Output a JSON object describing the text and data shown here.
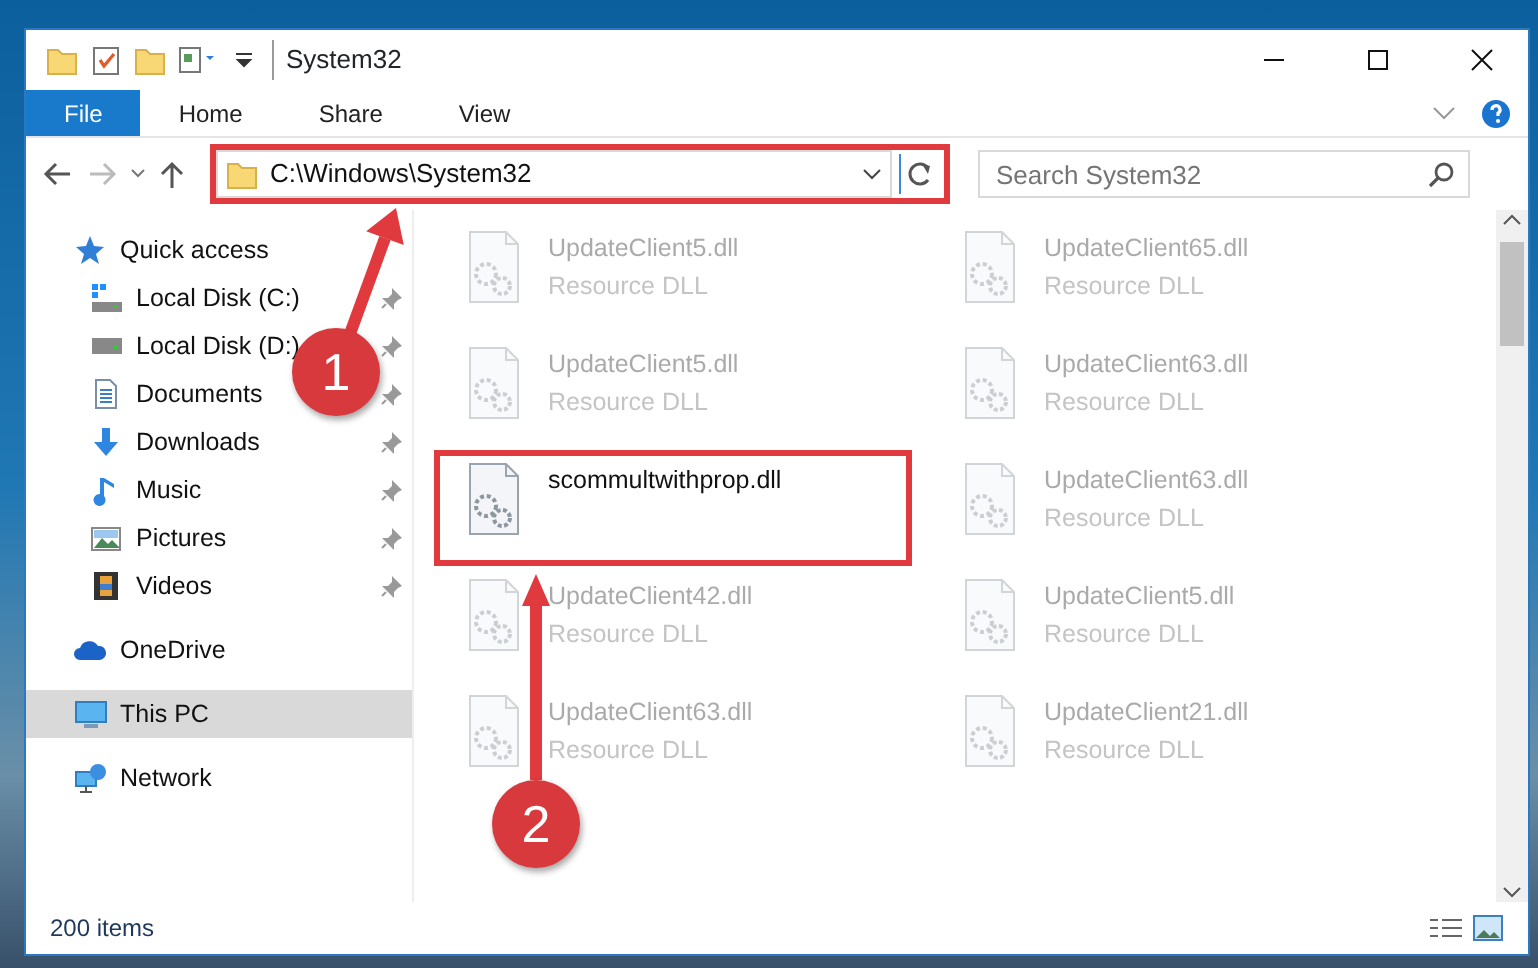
{
  "window": {
    "title": "System32"
  },
  "ribbon": {
    "tabs": [
      {
        "label": "File",
        "selected": true
      },
      {
        "label": "Home",
        "selected": false
      },
      {
        "label": "Share",
        "selected": false
      },
      {
        "label": "View",
        "selected": false
      }
    ]
  },
  "address": {
    "path": "C:\\Windows\\System32",
    "highlighted": true
  },
  "search": {
    "placeholder": "Search System32"
  },
  "nav": [
    {
      "label": "Quick access",
      "kind": "star",
      "selected": false,
      "children": [
        {
          "label": "Local Disk (C:)",
          "kind": "system-drive",
          "pinned": true,
          "selected": false
        },
        {
          "label": "Local Disk (D:)",
          "kind": "drive",
          "pinned": true,
          "selected": false
        },
        {
          "label": "Documents",
          "kind": "documents",
          "pinned": true,
          "selected": false
        },
        {
          "label": "Downloads",
          "kind": "downloads",
          "pinned": true,
          "selected": false
        },
        {
          "label": "Music",
          "kind": "music",
          "pinned": true,
          "selected": false
        },
        {
          "label": "Pictures",
          "kind": "pictures",
          "pinned": true,
          "selected": false
        },
        {
          "label": "Videos",
          "kind": "videos",
          "pinned": true,
          "selected": false
        }
      ]
    },
    {
      "label": "OneDrive",
      "kind": "cloud",
      "selected": false
    },
    {
      "label": "This PC",
      "kind": "computer",
      "selected": true
    },
    {
      "label": "Network",
      "kind": "network",
      "selected": false
    }
  ],
  "files": [
    {
      "name": "UpdateClient5.dll",
      "type": "Resource DLL",
      "selected": false
    },
    {
      "name": "UpdateClient65.dll",
      "type": "Resource DLL",
      "selected": false
    },
    {
      "name": "UpdateClient5.dll",
      "type": "Resource DLL",
      "selected": false
    },
    {
      "name": "UpdateClient63.dll",
      "type": "Resource DLL",
      "selected": false
    },
    {
      "name": "scommultwithprop.dll",
      "selected": true
    },
    {
      "name": "UpdateClient63.dll",
      "type": "Resource DLL",
      "selected": false
    },
    {
      "name": "UpdateClient42.dll",
      "type": "Resource DLL",
      "selected": false
    },
    {
      "name": "UpdateClient5.dll",
      "type": "Resource DLL",
      "selected": false
    },
    {
      "name": "UpdateClient63.dll",
      "type": "Resource DLL",
      "selected": false
    },
    {
      "name": "UpdateClient21.dll",
      "type": "Resource DLL",
      "selected": false
    }
  ],
  "annotations": [
    {
      "number": "1"
    },
    {
      "number": "2"
    }
  ],
  "status_bar": {
    "count": "200 items"
  }
}
